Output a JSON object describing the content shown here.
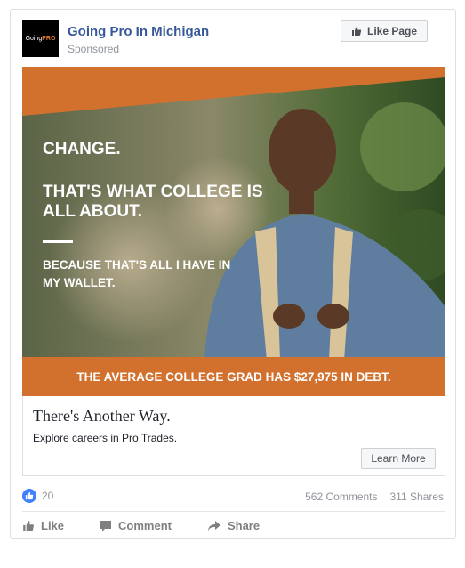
{
  "post": {
    "page_name": "Going Pro In Michigan",
    "sponsored": "Sponsored",
    "logo_text_left": "Going",
    "logo_text_right": "PRO",
    "like_page_label": "Like Page"
  },
  "ad": {
    "headline_1": "CHANGE.",
    "headline_2": "THAT'S WHAT COLLEGE IS ALL ABOUT.",
    "headline_3": "BECAUSE THAT'S ALL I HAVE IN MY WALLET.",
    "banner": "THE AVERAGE COLLEGE GRAD HAS $27,975 IN DEBT."
  },
  "link": {
    "title": "There's Another Way.",
    "description": "Explore careers in Pro Trades.",
    "cta_label": "Learn More"
  },
  "stats": {
    "likes": "20",
    "comments": "562 Comments",
    "shares": "311 Shares"
  },
  "actions": {
    "like": "Like",
    "comment": "Comment",
    "share": "Share"
  },
  "colors": {
    "accent_orange": "#d2712e",
    "link_blue": "#365899",
    "like_blue": "#4080ff"
  }
}
